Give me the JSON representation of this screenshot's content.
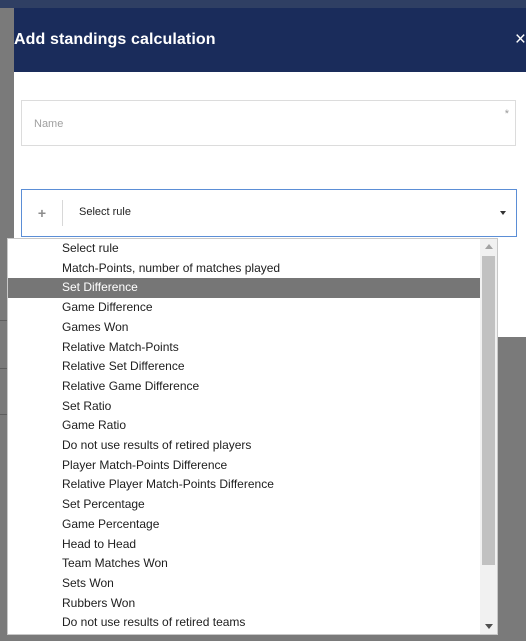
{
  "modal": {
    "title": "Add standings calculation",
    "close_label": "×"
  },
  "name_field": {
    "placeholder": "Name",
    "value": "",
    "required_mark": "*"
  },
  "rule_select": {
    "add_icon_glyph": "+",
    "selected_value": "Select rule",
    "options": [
      "Select rule",
      "Match-Points, number of matches played",
      "Set Difference",
      "Game Difference",
      "Games Won",
      "Relative Match-Points",
      "Relative Set Difference",
      "Relative Game Difference",
      "Set Ratio",
      "Game Ratio",
      "Do not use results of retired players",
      "Player Match-Points Difference",
      "Relative Player Match-Points Difference",
      "Set Percentage",
      "Game Percentage",
      "Head to Head",
      "Team Matches Won",
      "Sets Won",
      "Rubbers Won",
      "Do not use results of retired teams"
    ],
    "highlighted_option": "Set Difference"
  },
  "colors": {
    "header_bg": "#1a2c5b",
    "highlight_bg": "#767676",
    "focus_border": "#5b8ed6"
  },
  "icons": {
    "close": "close-icon",
    "add": "plus-icon",
    "caret": "chevron-down-icon",
    "scroll_up": "scroll-up-arrow-icon",
    "scroll_down": "scroll-down-arrow-icon"
  }
}
